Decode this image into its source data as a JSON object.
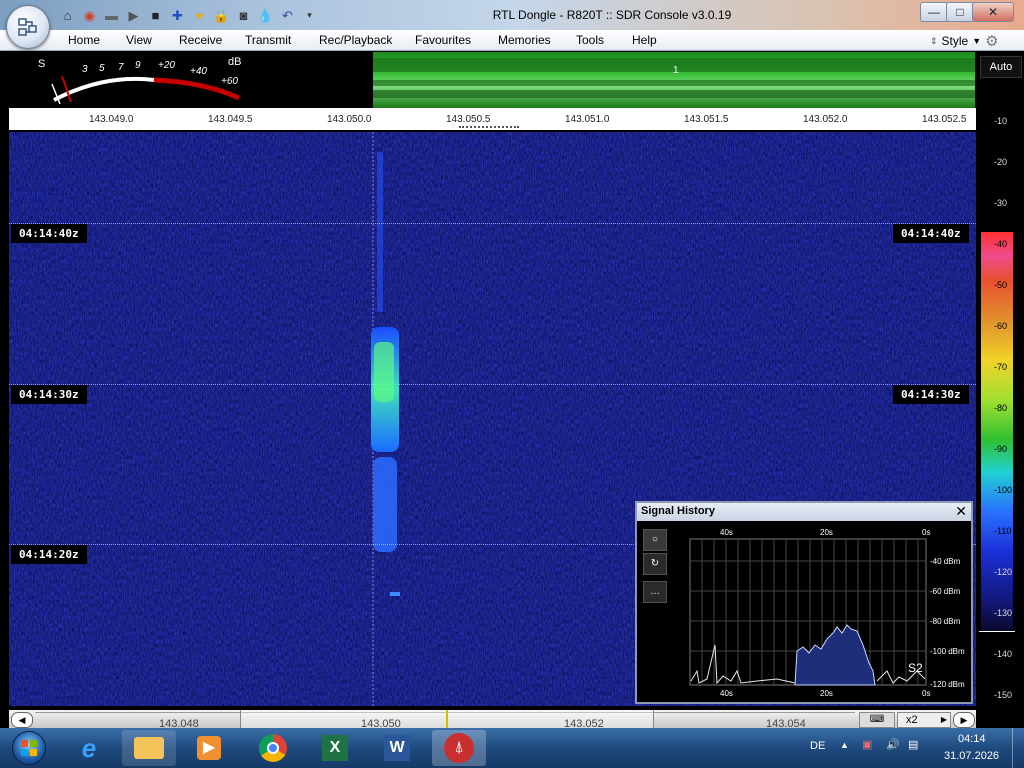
{
  "window": {
    "title": "RTL Dongle - R820T :: SDR Console v3.0.19",
    "buttons": {
      "minimize": "—",
      "maximize": "□",
      "close": "✕"
    }
  },
  "quick_access": [
    "home-icon",
    "lifebuoy-icon",
    "folder-icon",
    "play-icon",
    "stop-icon",
    "add-icon",
    "star-icon",
    "lock-icon",
    "camera-icon",
    "drop-icon",
    "undo-icon",
    "dropdown-icon"
  ],
  "menu": {
    "items": [
      "Home",
      "View",
      "Receive",
      "Transmit",
      "Rec/Playback",
      "Favourites",
      "Memories",
      "Tools",
      "Help"
    ],
    "style_label": "Style"
  },
  "meter": {
    "s_label": "S",
    "db_label": "dB",
    "scale": [
      "3",
      "5",
      "7",
      "9",
      "+20",
      "+40",
      "+60"
    ]
  },
  "spectrum": {
    "channel_marker": "1"
  },
  "freq_scale": {
    "labels": [
      "143.049.0",
      "143.049.5",
      "143.050.0",
      "143.050.5",
      "143.051.0",
      "143.051.5",
      "143.052.0",
      "143.052.5"
    ]
  },
  "right_scale": {
    "auto_label": "Auto",
    "db_ticks": [
      "-10",
      "-20",
      "-30",
      "-40",
      "-50",
      "-60",
      "-70",
      "-80",
      "-90",
      "-100",
      "-110",
      "-120",
      "-130",
      "-140",
      "-150"
    ]
  },
  "waterfall": {
    "times": [
      "04:14:40z",
      "04:14:30z",
      "04:14:20z"
    ]
  },
  "signal_history": {
    "title": "Signal History",
    "close": "✕",
    "time_top": [
      "40s",
      "20s",
      "0s"
    ],
    "time_bottom": [
      "40s",
      "20s",
      "0s"
    ],
    "dbm": [
      "-40 dBm",
      "-60 dBm",
      "-80 dBm",
      "-100 dBm",
      "-120 dBm"
    ],
    "s_reading": "S2",
    "side_buttons": [
      "○",
      "↻",
      "…"
    ]
  },
  "bottom": {
    "freqs": [
      "143.048",
      "143.050",
      "143.052",
      "143.054"
    ],
    "zoom": "x2"
  },
  "taskbar": {
    "apps": [
      "start-orb",
      "internet-explorer-icon",
      "file-explorer-icon",
      "media-player-icon",
      "chrome-icon",
      "excel-icon",
      "word-icon",
      "sdr-console-icon"
    ],
    "lang": "DE",
    "time": "04:14",
    "date": "31.07.2026"
  },
  "colors": {
    "waterfall_bg": "#0a0e5a",
    "accent_green": "#3abf3a",
    "menu_bg": "#ffffff"
  }
}
